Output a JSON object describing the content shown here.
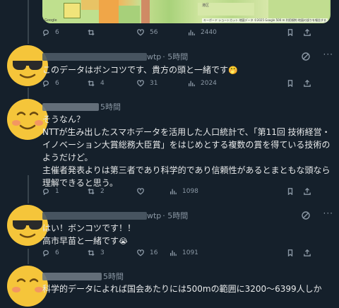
{
  "map": {
    "google_label": "Google",
    "attribution": "キーボード ショートカット 地図データ ©2025 Google 500 m 利用規約 地図の誤りを報告する",
    "place_label": "港区"
  },
  "tweets": [
    {
      "stats": {
        "replies": "6",
        "retweets": "",
        "likes": "56",
        "views": "2440"
      }
    },
    {
      "handle_suffix": "wtp",
      "time": "· 5時間",
      "text": "このデータはボンコツです、貴方の頭と一緒です",
      "emoji": "🤭",
      "stats": {
        "replies": "6",
        "retweets": "4",
        "likes": "31",
        "views": "2024"
      }
    },
    {
      "handle_suffix": "",
      "time": "5時間",
      "text": "そうなん？\nNTTが生み出したスマホデータを活用した人口統計で、「第11回 技術経営・イノベーション大賞総務大臣賞」をはじめとする複数の賞を得ている技術のようだけど。\n主催者発表よりは第三者であり科学的であり信頼性があるとまともな頭なら理解できると思う。",
      "emoji": "",
      "stats": {
        "replies": "1",
        "retweets": "2",
        "likes": "",
        "views": "1098"
      }
    },
    {
      "handle_suffix": "wtp",
      "time": "· 5時間",
      "text": "はい！ボンコツです！！\n高市早苗と一緒です",
      "emoji": "😭",
      "stats": {
        "replies": "6",
        "retweets": "3",
        "likes": "16",
        "views": "1091"
      }
    },
    {
      "handle_suffix": "",
      "time": "5時間",
      "text": "科学的データによれば国会あたりには500mの範囲に3200～6399人しか"
    }
  ],
  "icons": [
    "reply-icon",
    "retweet-icon",
    "heart-icon",
    "views-icon",
    "bookmark-icon",
    "share-icon",
    "grok-icon",
    "more-icon"
  ]
}
